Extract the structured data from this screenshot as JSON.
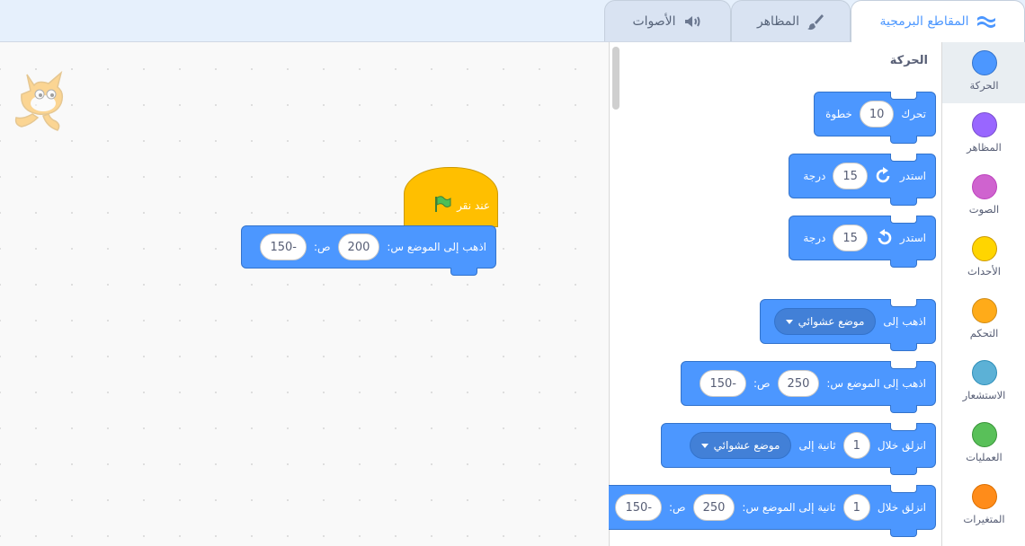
{
  "tabs": [
    {
      "label": "المقاطع البرمجية",
      "icon": "code-icon",
      "active": true
    },
    {
      "label": "المظاهر",
      "icon": "brush-icon",
      "active": false
    },
    {
      "label": "الأصوات",
      "icon": "speaker-icon",
      "active": false
    }
  ],
  "categories": [
    {
      "label": "الحركة",
      "color": "#4c97ff",
      "border": "#3373cc",
      "active": true
    },
    {
      "label": "المظاهر",
      "color": "#9966ff",
      "border": "#774dcb"
    },
    {
      "label": "الصوت",
      "color": "#cf63cf",
      "border": "#bd42bd"
    },
    {
      "label": "الأحداث",
      "color": "#ffd500",
      "border": "#cc9900"
    },
    {
      "label": "التحكم",
      "color": "#ffab19",
      "border": "#cf8b17"
    },
    {
      "label": "الاستشعار",
      "color": "#5cb1d6",
      "border": "#2e8eb8"
    },
    {
      "label": "العمليات",
      "color": "#59c059",
      "border": "#389438"
    },
    {
      "label": "المتغيرات",
      "color": "#ff8c1a",
      "border": "#db6e00"
    }
  ],
  "flyout": {
    "section_title": "الحركة",
    "move": {
      "text1": "تحرك",
      "value": "10",
      "text2": "خطوة"
    },
    "turn_right": {
      "text1": "استدر",
      "value": "15",
      "text2": "درجة"
    },
    "turn_left": {
      "text1": "استدر",
      "value": "15",
      "text2": "درجة"
    },
    "goto": {
      "text1": "اذهب إلى",
      "dropdown": "موضع عشوائي"
    },
    "goto_xy": {
      "text1": "اذهب إلى الموضع س:",
      "x": "250",
      "text2": "ص:",
      "y": "-150"
    },
    "glide": {
      "text1": "انزلق خلال",
      "value": "1",
      "text2": "ثانية إلى",
      "dropdown": "موضع عشوائي"
    },
    "glide_xy": {
      "text1": "انزلق خلال",
      "value": "1",
      "text2": "ثانية إلى الموضع س:",
      "x": "250",
      "text3": "ص:",
      "y": "-150"
    }
  },
  "workspace": {
    "hat": {
      "text": "عند نقر",
      "icon": "green-flag-icon"
    },
    "goto_xy": {
      "text1": "اذهب إلى الموضع س:",
      "x": "200",
      "text2": "ص:",
      "y": "-150"
    }
  },
  "colors": {
    "motion": "#4c97ff",
    "events": "#ffbf00",
    "tab_active": "#4c97ff"
  }
}
